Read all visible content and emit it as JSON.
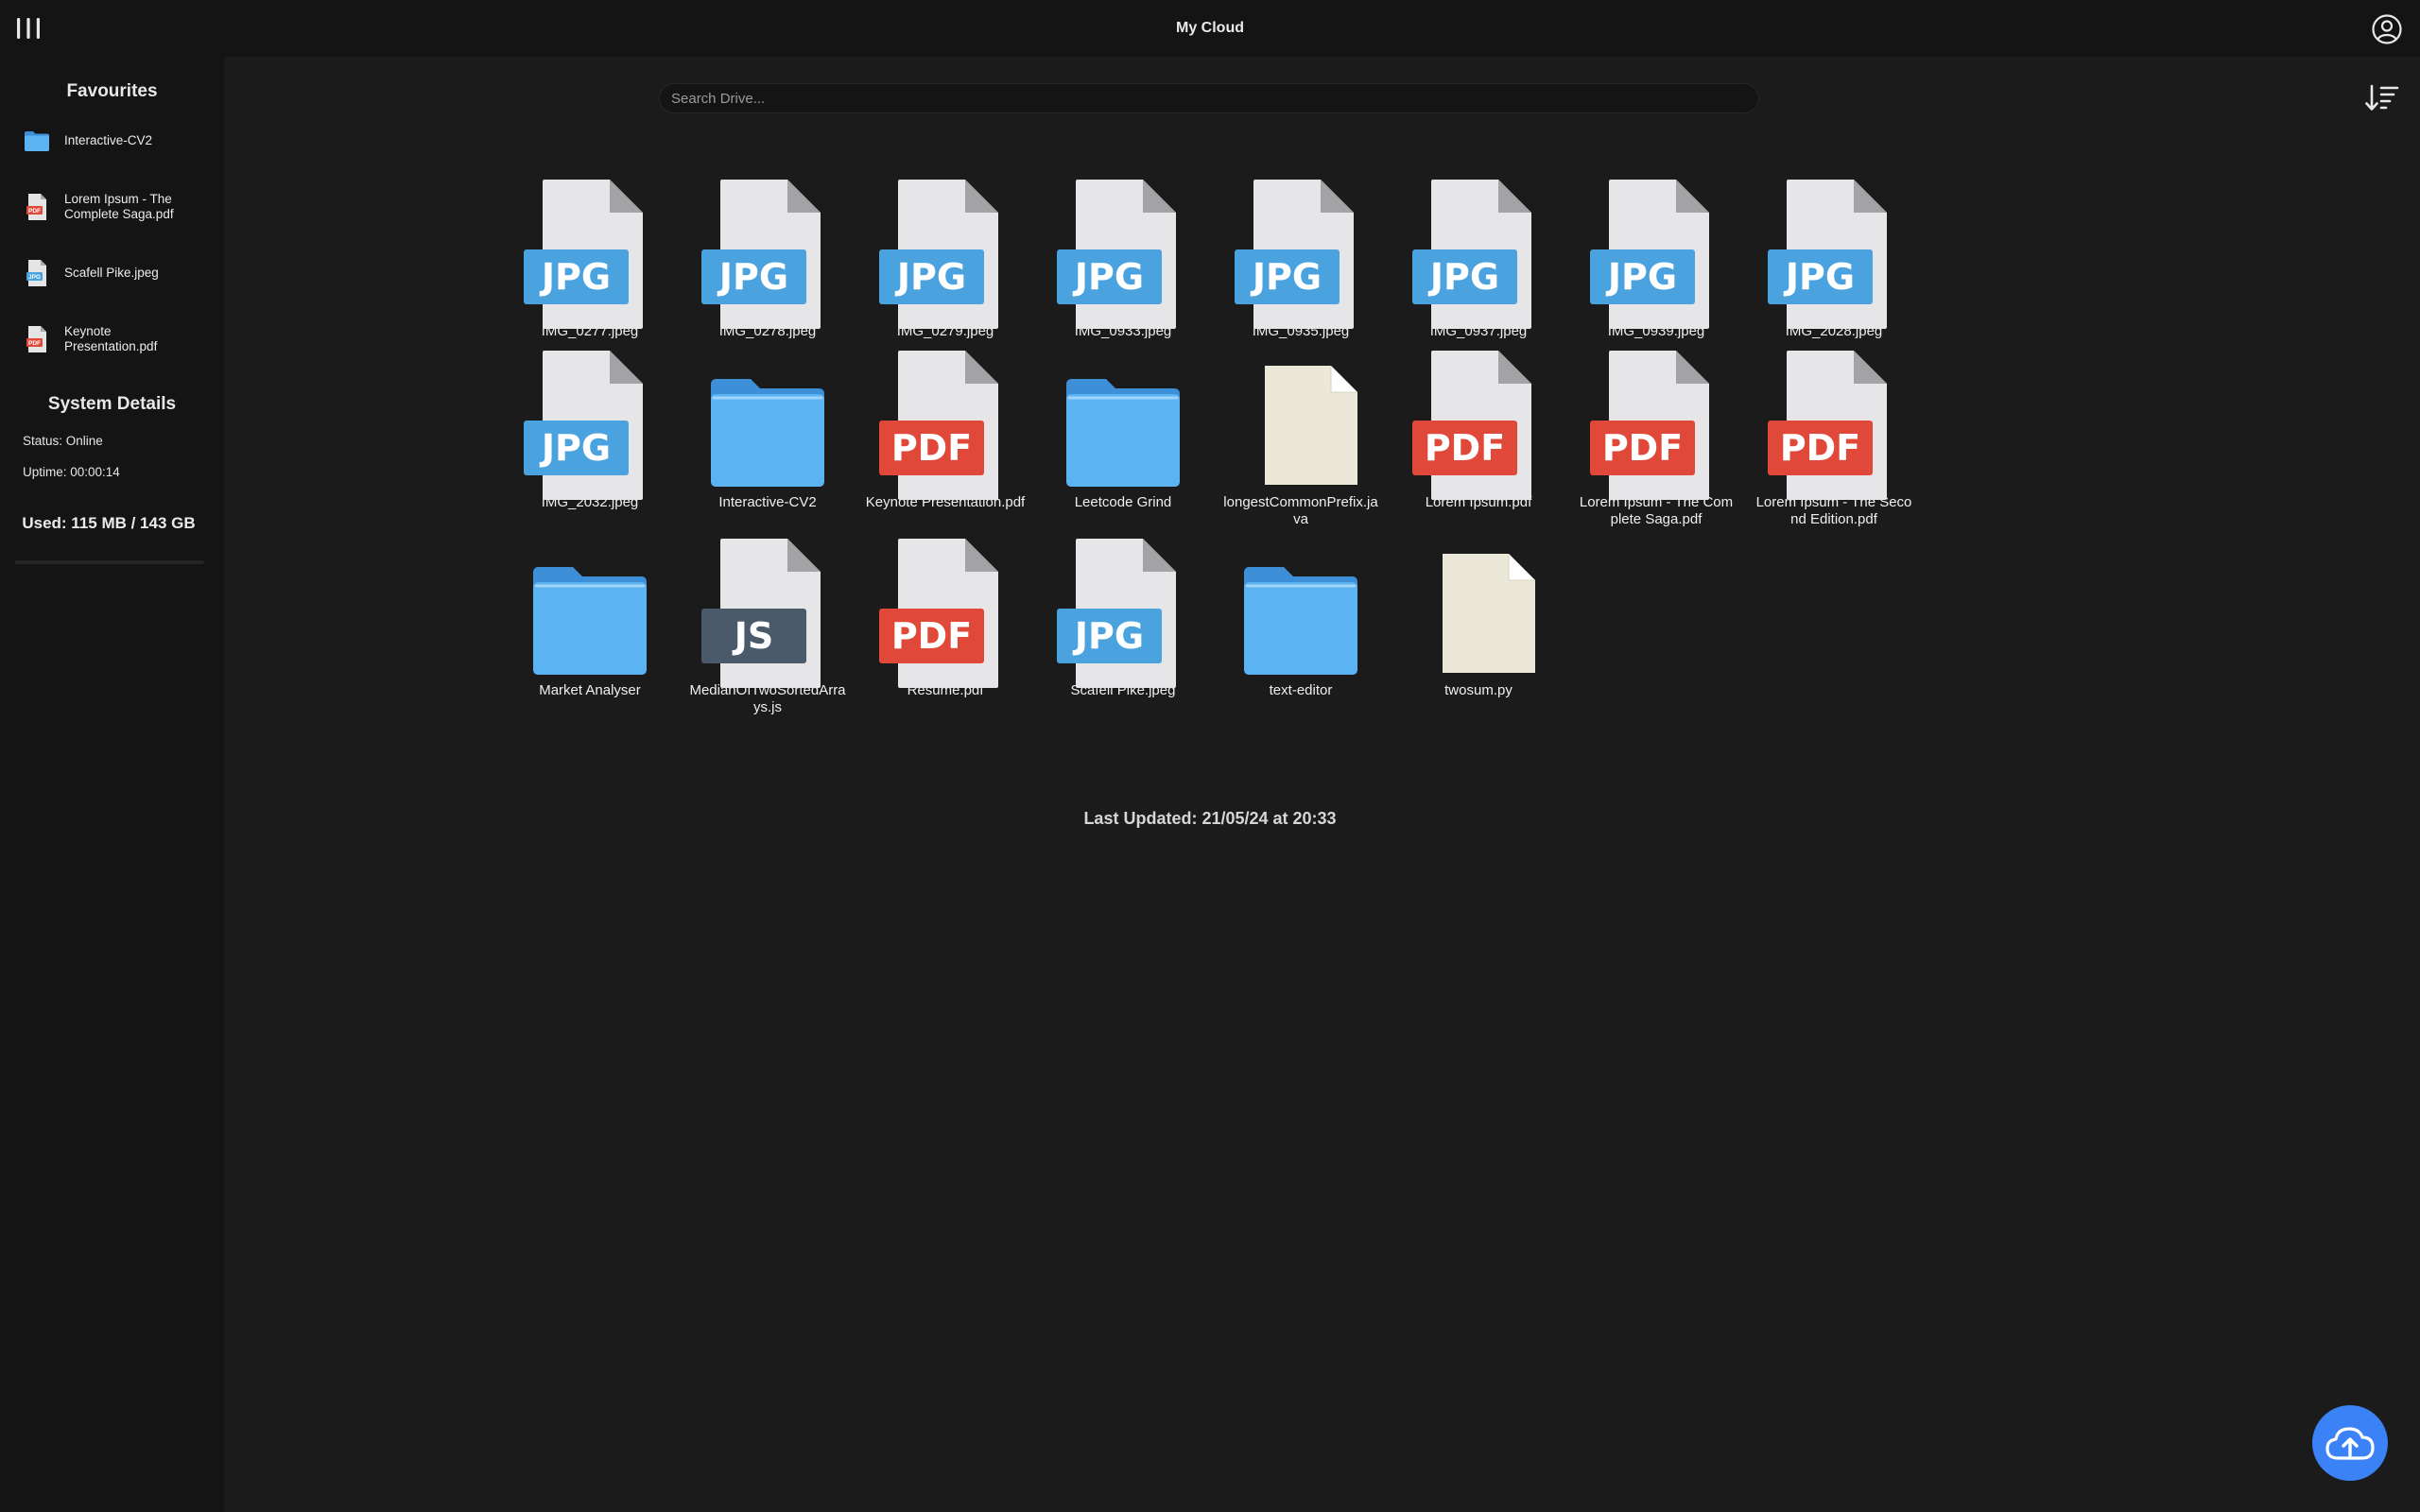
{
  "header": {
    "title": "My Cloud",
    "menu_icon": "menu-icon",
    "account_icon": "account-icon"
  },
  "sidebar": {
    "favourites_heading": "Favourites",
    "favourites": [
      {
        "label": "Interactive-CV2",
        "icon": "folder-icon"
      },
      {
        "label": "Lorem Ipsum - The Complete Saga.pdf",
        "icon": "pdf-file-icon"
      },
      {
        "label": "Scafell Pike.jpeg",
        "icon": "jpeg-file-icon"
      },
      {
        "label": "Keynote Presentation.pdf",
        "icon": "pdf-file-icon"
      }
    ],
    "system_heading": "System Details",
    "status": "Status: Online",
    "uptime": "Uptime: 00:00:14",
    "storage": "Used: 115 MB / 143 GB",
    "storage_fraction": 0.0008
  },
  "search": {
    "placeholder": "Search Drive..."
  },
  "sort_icon": "sort-descending-icon",
  "files": [
    {
      "name": "IMG_0277.jpeg",
      "type": "JPG"
    },
    {
      "name": "IMG_0278.jpeg",
      "type": "JPG"
    },
    {
      "name": "IMG_0279.jpeg",
      "type": "JPG"
    },
    {
      "name": "IMG_0933.jpeg",
      "type": "JPG"
    },
    {
      "name": "IMG_0935.jpeg",
      "type": "JPG"
    },
    {
      "name": "IMG_0937.jpeg",
      "type": "JPG"
    },
    {
      "name": "IMG_0939.jpeg",
      "type": "JPG"
    },
    {
      "name": "IMG_2028.jpeg",
      "type": "JPG"
    },
    {
      "name": "IMG_2032.jpeg",
      "type": "JPG"
    },
    {
      "name": "Interactive-CV2",
      "type": "folder"
    },
    {
      "name": "Keynote Presentation.pdf",
      "type": "PDF"
    },
    {
      "name": "Leetcode Grind",
      "type": "folder"
    },
    {
      "name": "longestCommonPrefix.java",
      "type": "text"
    },
    {
      "name": "Lorem Ipsum.pdf",
      "type": "PDF"
    },
    {
      "name": "Lorem Ipsum - The Complete Saga.pdf",
      "type": "PDF"
    },
    {
      "name": "Lorem Ipsum - The Second Edition.pdf",
      "type": "PDF"
    },
    {
      "name": "Market Analyser",
      "type": "folder"
    },
    {
      "name": "MedianOfTwoSortedArrays.js",
      "type": "JS"
    },
    {
      "name": "Resume.pdf",
      "type": "PDF"
    },
    {
      "name": "Scafell Pike.jpeg",
      "type": "JPG"
    },
    {
      "name": "text-editor",
      "type": "folder"
    },
    {
      "name": "twosum.py",
      "type": "text"
    }
  ],
  "last_updated": "Last Updated: 21/05/24 at 20:33",
  "upload_icon": "cloud-upload-icon",
  "colors": {
    "background": "#1b1b1b",
    "panel": "#141414",
    "jpg_badge": "#4aa3df",
    "pdf_badge": "#e0493a",
    "js_badge": "#4a5a6b",
    "folder": "#5cb3f2",
    "accent": "#3b82f6"
  }
}
